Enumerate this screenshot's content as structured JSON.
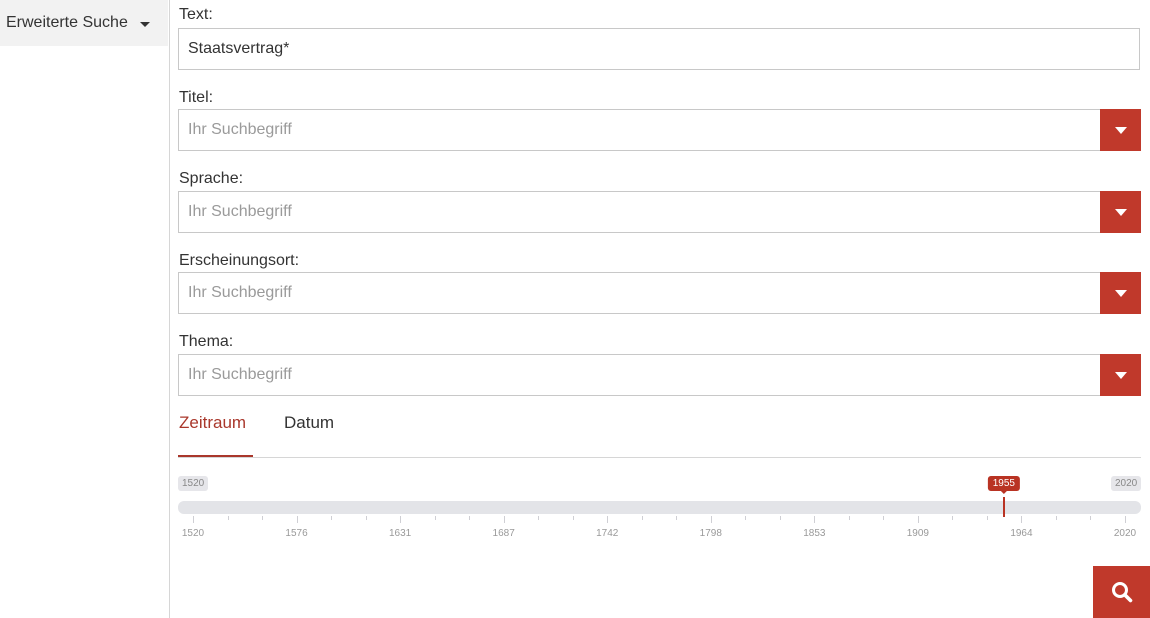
{
  "sidebar": {
    "advanced_search_label": "Erweiterte Suche"
  },
  "form": {
    "text": {
      "label": "Text:",
      "value": "Staatsvertrag*"
    },
    "titel": {
      "label": "Titel:",
      "placeholder": "Ihr Suchbegriff"
    },
    "sprache": {
      "label": "Sprache:",
      "placeholder": "Ihr Suchbegriff"
    },
    "erscheinungsort": {
      "label": "Erscheinungsort:",
      "placeholder": "Ihr Suchbegriff"
    },
    "thema": {
      "label": "Thema:",
      "placeholder": "Ihr Suchbegriff"
    }
  },
  "time_tabs": {
    "items": [
      {
        "label": "Zeitraum",
        "active": true
      },
      {
        "label": "Datum",
        "active": false
      }
    ]
  },
  "slider": {
    "min": 1520,
    "max": 2020,
    "value": 1955,
    "min_label": "1520",
    "max_label": "2020",
    "value_label": "1955",
    "tick_labels": [
      "1520",
      "1576",
      "1631",
      "1687",
      "1742",
      "1798",
      "1853",
      "1909",
      "1964",
      "2020"
    ]
  },
  "colors": {
    "accent": "#c0392b",
    "accent_text": "#a9372b"
  },
  "icons": {
    "dropdown": "caret-down-icon",
    "search": "search-icon"
  }
}
